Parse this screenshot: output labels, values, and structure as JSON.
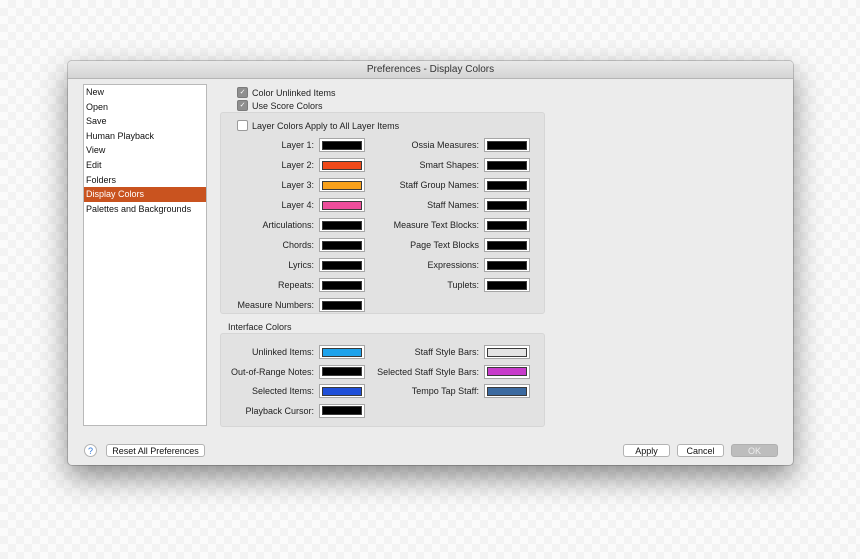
{
  "window": {
    "title": "Preferences - Display Colors"
  },
  "sidebar": {
    "items": [
      {
        "label": "New"
      },
      {
        "label": "Open"
      },
      {
        "label": "Save"
      },
      {
        "label": "Human Playback"
      },
      {
        "label": "View"
      },
      {
        "label": "Edit"
      },
      {
        "label": "Folders"
      },
      {
        "label": "Display Colors",
        "selected": true
      },
      {
        "label": "Palettes and Backgrounds"
      }
    ]
  },
  "options": {
    "color_unlinked": {
      "label": "Color Unlinked Items",
      "checked": true
    },
    "use_score_colors": {
      "label": "Use Score Colors",
      "checked": true
    },
    "layer_colors_all": {
      "label": "Layer Colors Apply to All Layer Items",
      "checked": false
    }
  },
  "score_colors": {
    "left": [
      {
        "label": "Layer 1:",
        "color": "#000000"
      },
      {
        "label": "Layer 2:",
        "color": "#f04a1a"
      },
      {
        "label": "Layer 3:",
        "color": "#f9a11b"
      },
      {
        "label": "Layer 4:",
        "color": "#ee4d9b"
      },
      {
        "label": "Articulations:",
        "color": "#000000"
      },
      {
        "label": "Chords:",
        "color": "#000000"
      },
      {
        "label": "Lyrics:",
        "color": "#000000"
      },
      {
        "label": "Repeats:",
        "color": "#000000"
      },
      {
        "label": "Measure Numbers:",
        "color": "#000000"
      }
    ],
    "right": [
      {
        "label": "Ossia Measures:",
        "color": "#000000"
      },
      {
        "label": "Smart Shapes:",
        "color": "#000000"
      },
      {
        "label": "Staff Group Names:",
        "color": "#000000"
      },
      {
        "label": "Staff Names:",
        "color": "#000000"
      },
      {
        "label": "Measure Text Blocks:",
        "color": "#000000"
      },
      {
        "label": "Page Text Blocks",
        "color": "#000000"
      },
      {
        "label": "Expressions:",
        "color": "#000000"
      },
      {
        "label": "Tuplets:",
        "color": "#000000"
      }
    ]
  },
  "interface_colors": {
    "title": "Interface Colors",
    "left": [
      {
        "label": "Unlinked Items:",
        "color": "#1ea3ec"
      },
      {
        "label": "Out-of-Range Notes:",
        "color": "#000000"
      },
      {
        "label": "Selected Items:",
        "color": "#1f4fd8"
      },
      {
        "label": "Playback Cursor:",
        "color": "#000000"
      }
    ],
    "right": [
      {
        "label": "Staff Style Bars:",
        "color": "#e4e4e4"
      },
      {
        "label": "Selected Staff Style Bars:",
        "color": "#c83ccb"
      },
      {
        "label": "Tempo Tap Staff:",
        "color": "#3b6aa0"
      }
    ]
  },
  "footer": {
    "help": "?",
    "reset": "Reset All Preferences",
    "apply": "Apply",
    "cancel": "Cancel",
    "ok": "OK"
  }
}
